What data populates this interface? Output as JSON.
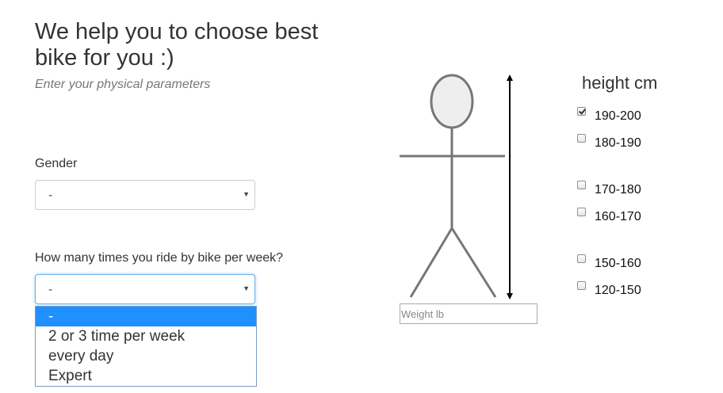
{
  "header": {
    "title": "We help you to choose best bike for you :)",
    "subtitle": "Enter your physical parameters"
  },
  "gender": {
    "label": "Gender",
    "value": "-"
  },
  "rides": {
    "label": "How many times you ride by bike per week?",
    "value": "-",
    "options": [
      "-",
      "2 or 3 time per week",
      "every day",
      "Expert"
    ],
    "selected_index": 0
  },
  "weight": {
    "placeholder": "Weight lb",
    "value": ""
  },
  "height": {
    "title": "height cm",
    "options": [
      {
        "label": "190-200",
        "checked": true
      },
      {
        "label": "180-190",
        "checked": false
      },
      {
        "label": "170-180",
        "checked": false
      },
      {
        "label": "160-170",
        "checked": false
      },
      {
        "label": "150-160",
        "checked": false
      },
      {
        "label": "120-150",
        "checked": false
      }
    ]
  },
  "colors": {
    "highlight": "#1e90ff",
    "figure_stroke": "#777777",
    "head_fill": "#eeeeee"
  }
}
